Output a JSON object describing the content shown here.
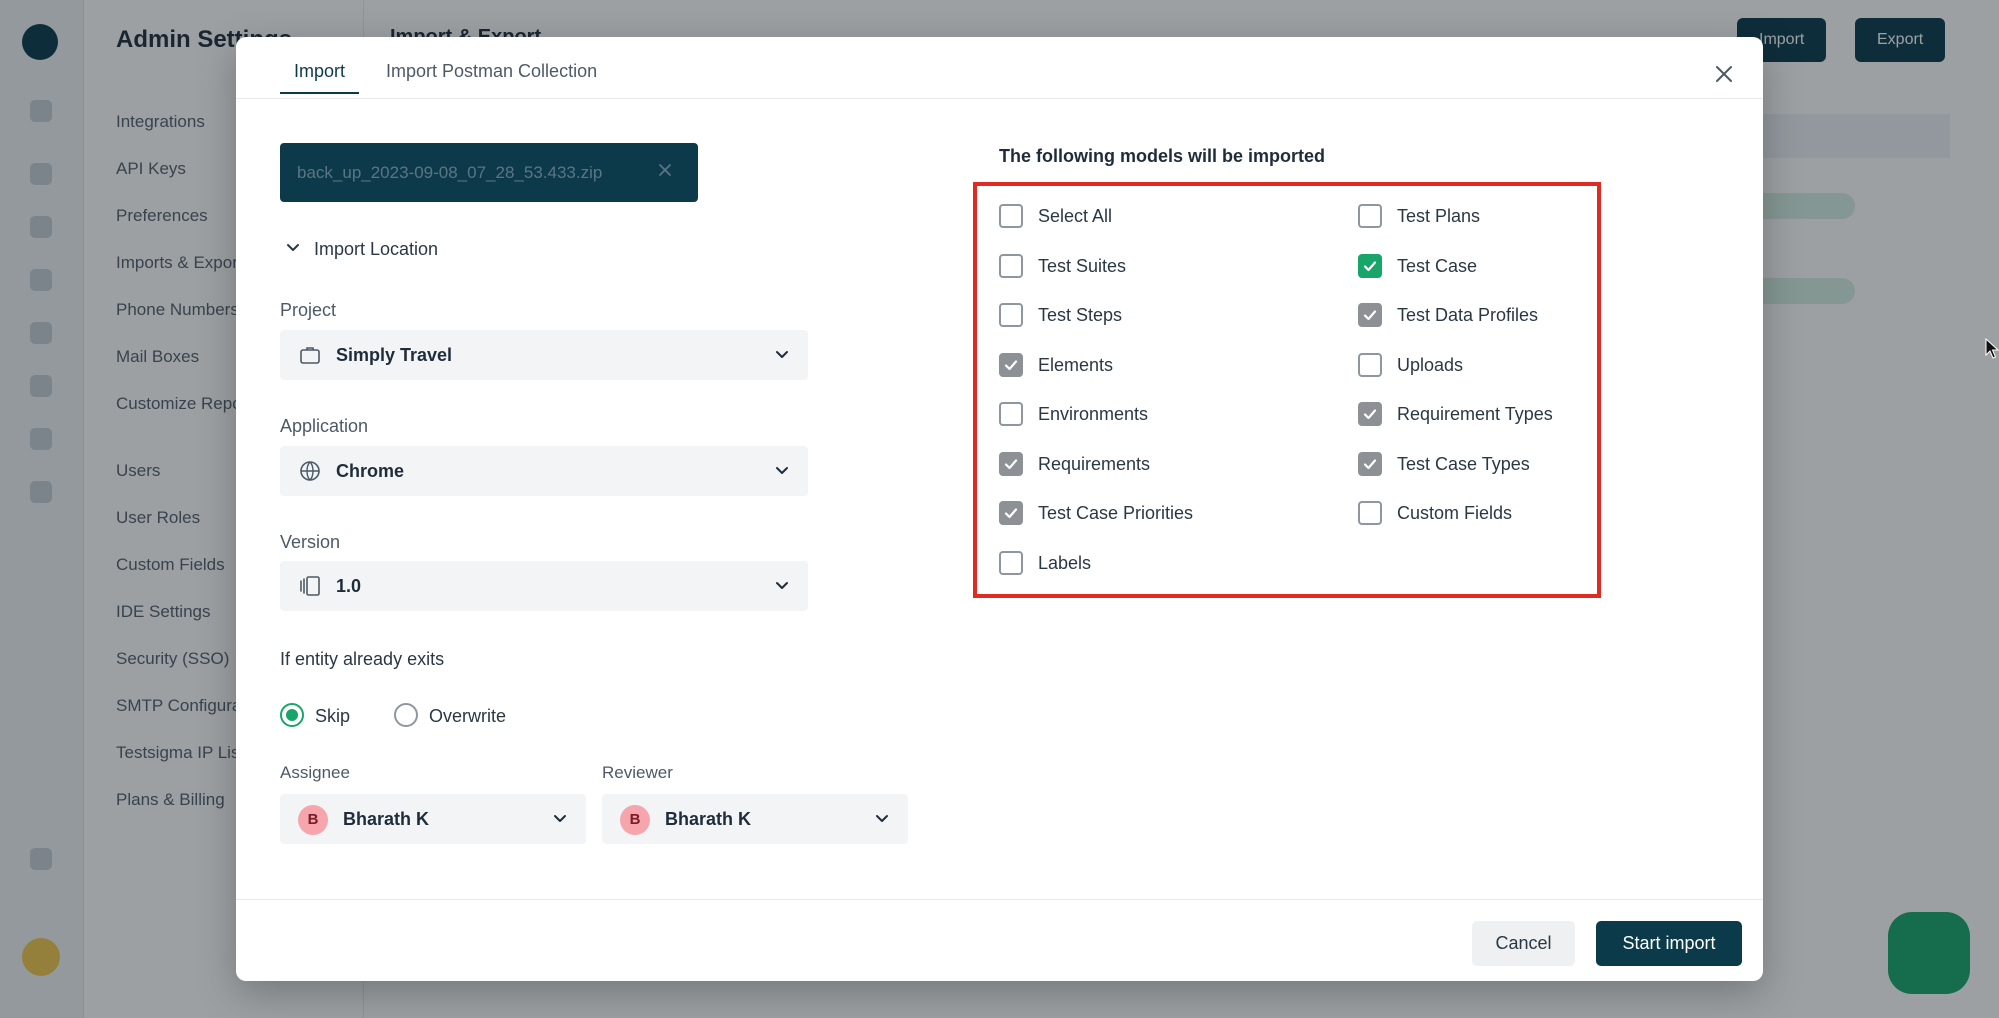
{
  "background": {
    "sidebar_title": "Admin Settings",
    "page_title": "Import & Export",
    "buttons": [
      "Import",
      "Export"
    ],
    "menu_items": [
      "Integrations",
      "API Keys",
      "Preferences",
      "Imports & Exports",
      "Phone Numbers",
      "Mail Boxes",
      "Customize Reports",
      "Users",
      "User Roles",
      "Custom Fields",
      "IDE Settings",
      "Security (SSO)",
      "SMTP Configuration",
      "Testsigma IP List",
      "Plans & Billing"
    ]
  },
  "modal": {
    "tabs": [
      "Import",
      "Import Postman Collection"
    ],
    "active_tab": "Import",
    "file_name": "back_up_2023-09-08_07_28_53.433.zip",
    "section_title": "Import Location",
    "project": {
      "label": "Project",
      "value": "Simply Travel",
      "icon": "briefcase-icon"
    },
    "application": {
      "label": "Application",
      "value": "Chrome",
      "icon": "globe-icon"
    },
    "version": {
      "label": "Version",
      "value": "1.0",
      "icon": "versions-icon"
    },
    "entity_label": "If entity already exits",
    "entity_options": [
      {
        "label": "Skip",
        "selected": true
      },
      {
        "label": "Overwrite",
        "selected": false
      }
    ],
    "assignee": {
      "label": "Assignee",
      "value": "Bharath K",
      "initial": "B"
    },
    "reviewer": {
      "label": "Reviewer",
      "value": "Bharath K",
      "initial": "B"
    },
    "models_title": "The following models will be imported",
    "models_left": [
      {
        "label": "Select All",
        "checked": false
      },
      {
        "label": "Test Suites",
        "checked": false
      },
      {
        "label": "Test Steps",
        "checked": false
      },
      {
        "label": "Elements",
        "checked": true
      },
      {
        "label": "Environments",
        "checked": false
      },
      {
        "label": "Requirements",
        "checked": true
      },
      {
        "label": "Test Case Priorities",
        "checked": true
      },
      {
        "label": "Labels",
        "checked": false
      }
    ],
    "models_right": [
      {
        "label": "Test Plans",
        "checked": false
      },
      {
        "label": "Test Case",
        "checked": true,
        "accent": "#18a56a"
      },
      {
        "label": "Test Data Profiles",
        "checked": true
      },
      {
        "label": "Uploads",
        "checked": false
      },
      {
        "label": "Requirement Types",
        "checked": true
      },
      {
        "label": "Test Case Types",
        "checked": true
      },
      {
        "label": "Custom Fields",
        "checked": false
      }
    ],
    "cancel_label": "Cancel",
    "start_label": "Start import"
  },
  "colors": {
    "brand_dark": "#0b3a4a",
    "accent_green": "#18a56a",
    "highlight_red": "#e02b22"
  }
}
